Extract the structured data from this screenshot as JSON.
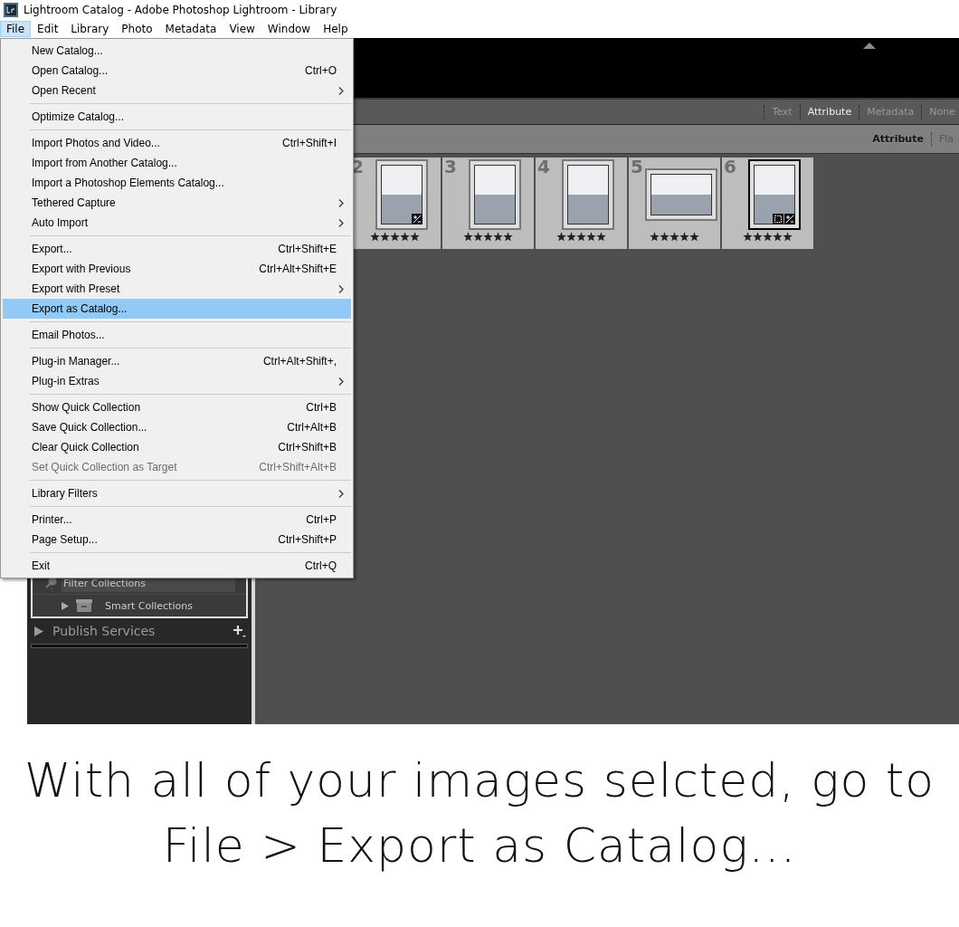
{
  "window": {
    "title": "Lightroom Catalog - Adobe Photoshop Lightroom - Library"
  },
  "menubar": [
    {
      "label": "File",
      "selected": true
    },
    {
      "label": "Edit",
      "selected": false
    },
    {
      "label": "Library",
      "selected": false
    },
    {
      "label": "Photo",
      "selected": false
    },
    {
      "label": "Metadata",
      "selected": false
    },
    {
      "label": "View",
      "selected": false
    },
    {
      "label": "Window",
      "selected": false
    },
    {
      "label": "Help",
      "selected": false
    }
  ],
  "menu": {
    "groups": [
      [
        {
          "label": "New Catalog...",
          "submenu": false,
          "disabled": false,
          "selected": false
        },
        {
          "label": "Open Catalog...",
          "shortcut": "Ctrl+O",
          "submenu": false,
          "disabled": false,
          "selected": false
        },
        {
          "label": "Open Recent",
          "submenu": true,
          "disabled": false,
          "selected": false
        }
      ],
      [
        {
          "label": "Optimize Catalog...",
          "submenu": false,
          "disabled": false,
          "selected": false
        }
      ],
      [
        {
          "label": "Import Photos and Video...",
          "shortcut": "Ctrl+Shift+I",
          "submenu": false,
          "disabled": false,
          "selected": false
        },
        {
          "label": "Import from Another Catalog...",
          "submenu": false,
          "disabled": false,
          "selected": false
        },
        {
          "label": "Import a Photoshop Elements Catalog...",
          "submenu": false,
          "disabled": false,
          "selected": false
        },
        {
          "label": "Tethered Capture",
          "submenu": true,
          "disabled": false,
          "selected": false
        },
        {
          "label": "Auto Import",
          "submenu": true,
          "disabled": false,
          "selected": false
        }
      ],
      [
        {
          "label": "Export...",
          "shortcut": "Ctrl+Shift+E",
          "submenu": false,
          "disabled": false,
          "selected": false
        },
        {
          "label": "Export with Previous",
          "shortcut": "Ctrl+Alt+Shift+E",
          "submenu": false,
          "disabled": false,
          "selected": false
        },
        {
          "label": "Export with Preset",
          "submenu": true,
          "disabled": false,
          "selected": false
        },
        {
          "label": "Export as Catalog...",
          "submenu": false,
          "disabled": false,
          "selected": true
        }
      ],
      [
        {
          "label": "Email Photos...",
          "submenu": false,
          "disabled": false,
          "selected": false
        }
      ],
      [
        {
          "label": "Plug-in Manager...",
          "shortcut": "Ctrl+Alt+Shift+,",
          "submenu": false,
          "disabled": false,
          "selected": false
        },
        {
          "label": "Plug-in Extras",
          "submenu": true,
          "disabled": false,
          "selected": false
        }
      ],
      [
        {
          "label": "Show Quick Collection",
          "shortcut": "Ctrl+B",
          "submenu": false,
          "disabled": false,
          "selected": false
        },
        {
          "label": "Save Quick Collection...",
          "shortcut": "Ctrl+Alt+B",
          "submenu": false,
          "disabled": false,
          "selected": false
        },
        {
          "label": "Clear Quick Collection",
          "shortcut": "Ctrl+Shift+B",
          "submenu": false,
          "disabled": false,
          "selected": false
        },
        {
          "label": "Set Quick Collection as Target",
          "shortcut": "Ctrl+Shift+Alt+B",
          "submenu": false,
          "disabled": true,
          "selected": false
        }
      ],
      [
        {
          "label": "Library Filters",
          "submenu": true,
          "disabled": false,
          "selected": false
        }
      ],
      [
        {
          "label": "Printer...",
          "shortcut": "Ctrl+P",
          "submenu": false,
          "disabled": false,
          "selected": false
        },
        {
          "label": "Page Setup...",
          "shortcut": "Ctrl+Shift+P",
          "submenu": false,
          "disabled": false,
          "selected": false
        }
      ],
      [
        {
          "label": "Exit",
          "shortcut": "Ctrl+Q",
          "submenu": false,
          "disabled": false,
          "selected": false
        }
      ]
    ]
  },
  "left_panel": {
    "filter_field": {
      "placeholder": "Filter Collections"
    },
    "smart_collections": "Smart Collections",
    "publish_services": "Publish Services"
  },
  "filter_bar": {
    "tabs": [
      {
        "label": "Text",
        "selected": false
      },
      {
        "label": "Attribute",
        "selected": true
      },
      {
        "label": "Metadata",
        "selected": false
      },
      {
        "label": "None",
        "selected": false
      }
    ]
  },
  "attribute_bar": {
    "items": [
      {
        "label": "Attribute",
        "selected": true
      },
      {
        "label": "Fla",
        "selected": false
      }
    ]
  },
  "thumbnails": [
    {
      "number": "2",
      "kind": "portrait",
      "stars": 5,
      "cropped": false,
      "edited": true,
      "selected": false
    },
    {
      "number": "3",
      "kind": "portrait",
      "stars": 5,
      "cropped": false,
      "edited": false,
      "selected": false
    },
    {
      "number": "4",
      "kind": "portrait",
      "stars": 5,
      "cropped": false,
      "edited": false,
      "selected": false
    },
    {
      "number": "5",
      "kind": "landscape",
      "stars": 5,
      "cropped": false,
      "edited": false,
      "selected": false
    },
    {
      "number": "6",
      "kind": "portrait",
      "stars": 5,
      "cropped": true,
      "edited": true,
      "selected": true
    }
  ],
  "caption": {
    "lines": [
      "With all of your images selcted, go to",
      "File > Export as Catalog..."
    ]
  }
}
